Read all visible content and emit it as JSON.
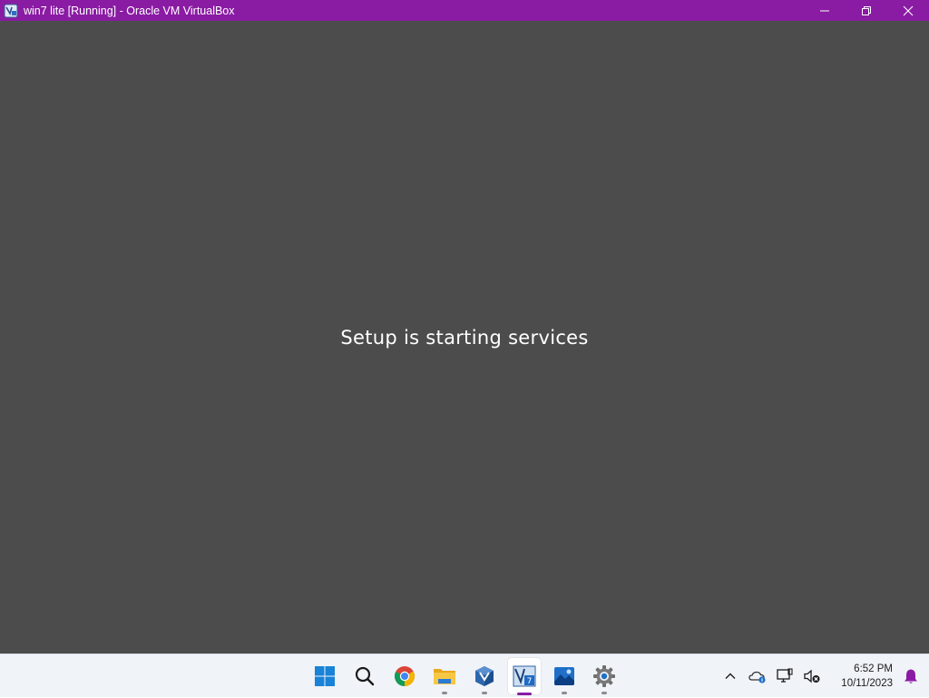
{
  "window": {
    "title": "win7 lite [Running] - Oracle VM VirtualBox",
    "titlebar_color": "#8a1ba3",
    "controls": [
      "minimize-icon",
      "restore-icon",
      "close-icon"
    ]
  },
  "vm_screen": {
    "background": "#4c4c4c",
    "message": "Setup is starting services"
  },
  "taskbar": {
    "apps": [
      {
        "name": "start",
        "icon": "windows-logo-icon",
        "running": false
      },
      {
        "name": "search",
        "icon": "search-icon",
        "running": false
      },
      {
        "name": "chrome",
        "icon": "chrome-icon",
        "running": false
      },
      {
        "name": "file-explorer",
        "icon": "folder-icon",
        "running": true
      },
      {
        "name": "virtualbox",
        "icon": "virtualbox-icon",
        "running": true
      },
      {
        "name": "vm-window",
        "icon": "win7-vm-icon",
        "running": true,
        "active": true
      },
      {
        "name": "photos",
        "icon": "photos-icon",
        "running": true
      },
      {
        "name": "settings",
        "icon": "gear-icon",
        "running": true
      }
    ],
    "tray": {
      "icons": [
        "chevron-up-icon",
        "onedrive-icon",
        "network-icon",
        "volume-muted-icon"
      ],
      "time": "6:52 PM",
      "date": "10/11/2023",
      "notification_icon": "bell-icon"
    }
  }
}
